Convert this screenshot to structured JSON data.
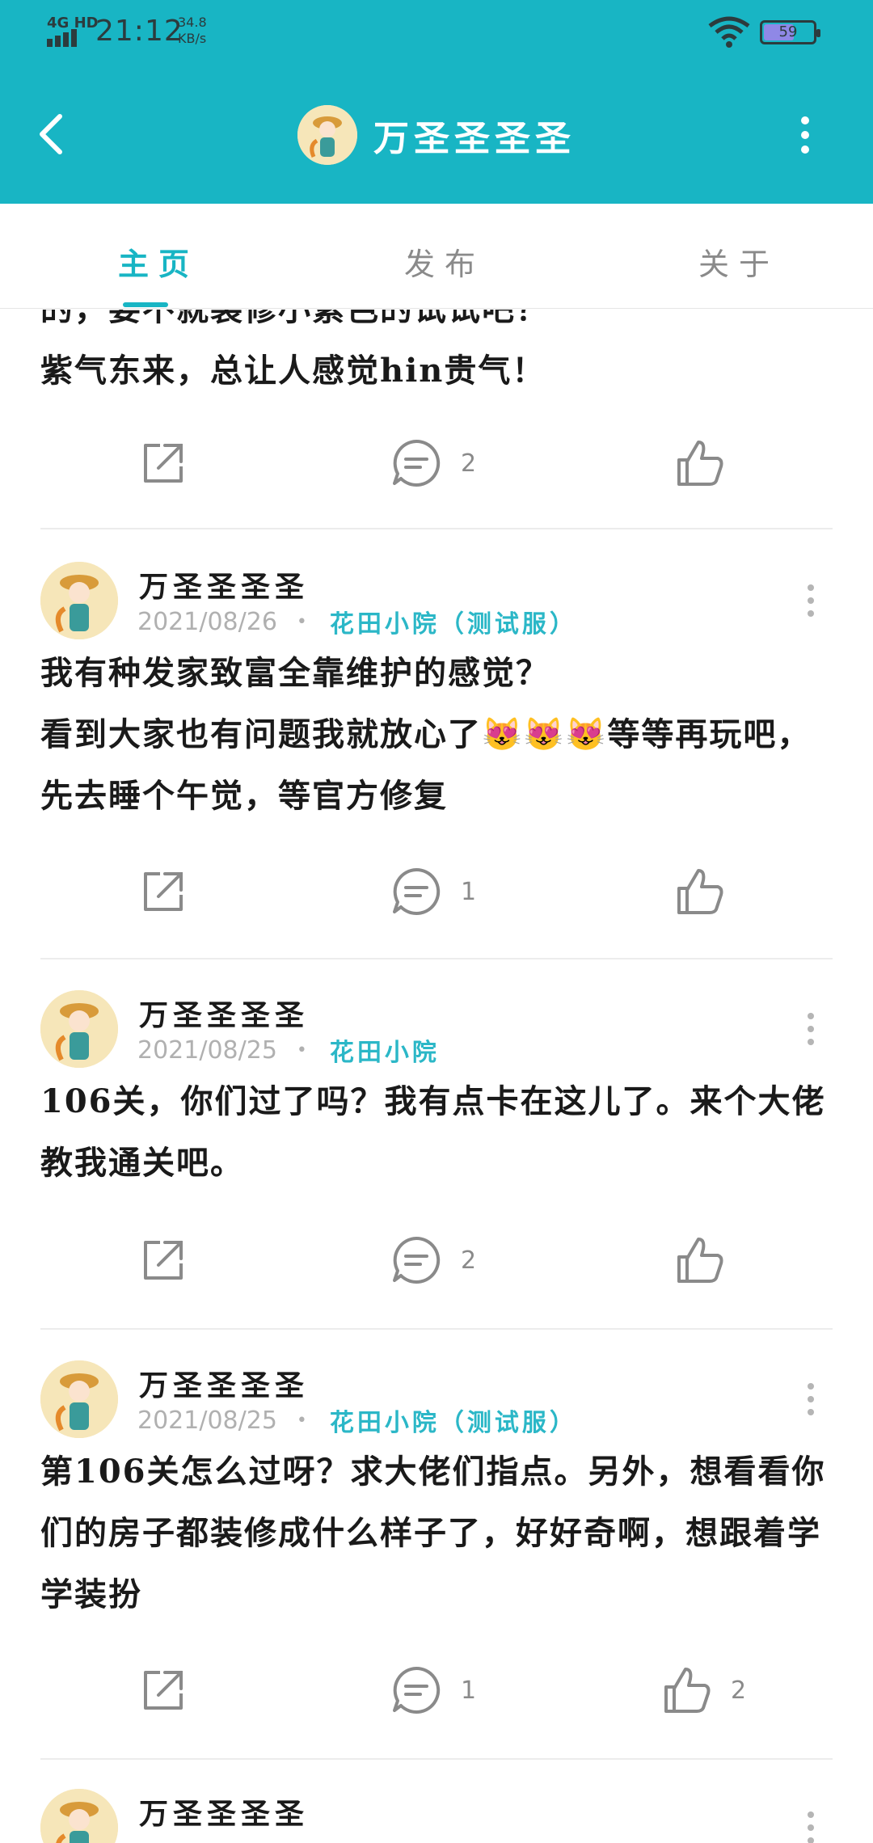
{
  "status_bar": {
    "network": "4G HD",
    "time": "21:12",
    "speed_value": "34.8",
    "speed_unit": "KB/s",
    "battery": "59"
  },
  "header": {
    "title": "万圣圣圣圣",
    "background": "#18b5c4"
  },
  "tabs": [
    {
      "label": "主页",
      "active": true
    },
    {
      "label": "发布",
      "active": false
    },
    {
      "label": "关于",
      "active": false
    }
  ],
  "feed": {
    "partial_post": {
      "text": "的，要不就装修小紫色的试试吧？\n紫气东来，总让人感觉hin贵气！",
      "comments": "2",
      "likes": ""
    },
    "posts": [
      {
        "author": "万圣圣圣圣",
        "date": "2021/08/26",
        "group": "花田小院（测试服）",
        "text": "我有种发家致富全靠维护的感觉？\n看到大家也有问题我就放心了😻😻😻等等再玩吧，先去睡个午觉，等官方修复",
        "comments": "1",
        "likes": ""
      },
      {
        "author": "万圣圣圣圣",
        "date": "2021/08/25",
        "group": "花田小院",
        "text": "106关，你们过了吗？我有点卡在这儿了。来个大佬教我通关吧。",
        "comments": "2",
        "likes": ""
      },
      {
        "author": "万圣圣圣圣",
        "date": "2021/08/25",
        "group": "花田小院（测试服）",
        "text": "第106关怎么过呀？求大佬们指点。另外，想看看你们的房子都装修成什么样子了，好好奇啊，想跟着学学装扮",
        "comments": "1",
        "likes": "2"
      },
      {
        "author": "万圣圣圣圣",
        "date": "",
        "group": "",
        "text": "",
        "comments": "",
        "likes": ""
      }
    ]
  },
  "icons": {
    "back": "chevron-left-icon",
    "more": "more-vertical-icon",
    "share": "share-icon",
    "comment": "comment-icon",
    "like": "thumbs-up-icon"
  },
  "colors": {
    "accent": "#18b5c4",
    "group_text": "#2bb7c7",
    "meta_text": "#b0b0b0"
  }
}
